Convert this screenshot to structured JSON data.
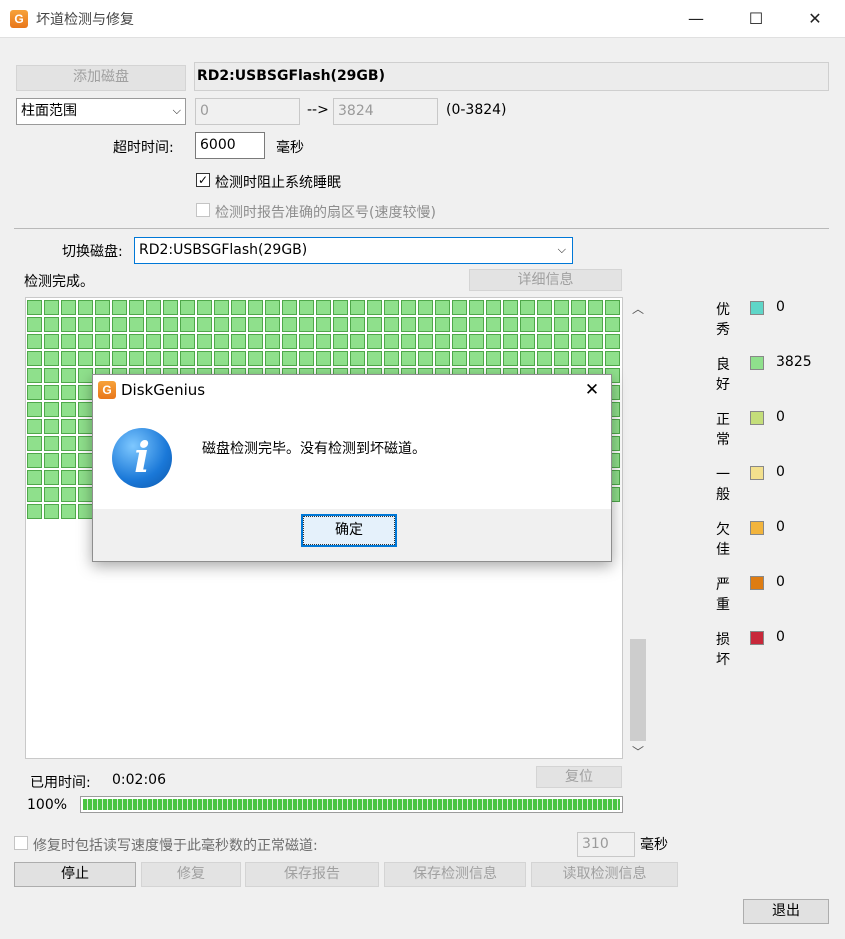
{
  "window": {
    "title": "坏道检测与修复",
    "min_glyph": "—",
    "max_glyph": "☐",
    "close_glyph": "✕"
  },
  "top": {
    "add_disk_button": "添加磁盘",
    "disk_name": "RD2:USBSGFlash(29GB)",
    "range_select": "柱面范围",
    "range_from": "0",
    "range_arrow": "-->",
    "range_to": "3824",
    "range_hint": "(0-3824)",
    "timeout_label": "超时时间:",
    "timeout_value": "6000",
    "timeout_unit": "毫秒",
    "prevent_sleep_label": "检测时阻止系统睡眠",
    "prevent_sleep_checked": true,
    "report_sector_label": "检测时报告准确的扇区号(速度较慢)",
    "report_sector_checked": false
  },
  "middle": {
    "switch_disk_label": "切换磁盘:",
    "switch_disk_value": "RD2:USBSGFlash(29GB)",
    "status_text": "检测完成。",
    "details_button": "详细信息"
  },
  "grid": {
    "total_cells": 441,
    "cell_status": "良好"
  },
  "legend": [
    {
      "name": "优秀",
      "count": "0",
      "color": "#5fd6c8"
    },
    {
      "name": "良好",
      "count": "3825",
      "color": "#8fe08c"
    },
    {
      "name": "正常",
      "count": "0",
      "color": "#c4de7a"
    },
    {
      "name": "一般",
      "count": "0",
      "color": "#f3e08d"
    },
    {
      "name": "欠佳",
      "count": "0",
      "color": "#f2b43c"
    },
    {
      "name": "严重",
      "count": "0",
      "color": "#de7c12"
    },
    {
      "name": "损坏",
      "count": "0",
      "color": "#c8283a"
    }
  ],
  "progress": {
    "elapsed_label": "已用时间:",
    "elapsed_value": "0:02:06",
    "reset_button": "复位",
    "percent_text": "100%",
    "percent": 100
  },
  "bottom": {
    "repair_slow_label": "修复时包括读写速度慢于此毫秒数的正常磁道:",
    "repair_slow_checked": false,
    "repair_slow_value": "310",
    "repair_slow_unit": "毫秒",
    "stop_button": "停止",
    "repair_button": "修复",
    "save_report_button": "保存报告",
    "save_info_button": "保存检测信息",
    "load_info_button": "读取检测信息",
    "exit_button": "退出"
  },
  "dialog": {
    "title": "DiskGenius",
    "message": "磁盘检测完毕。没有检测到坏磁道。",
    "ok_button": "确定",
    "close_glyph": "✕",
    "icon_glyph": "i"
  },
  "colors": {
    "accent": "#0078d7",
    "good": "#8fe08c"
  }
}
